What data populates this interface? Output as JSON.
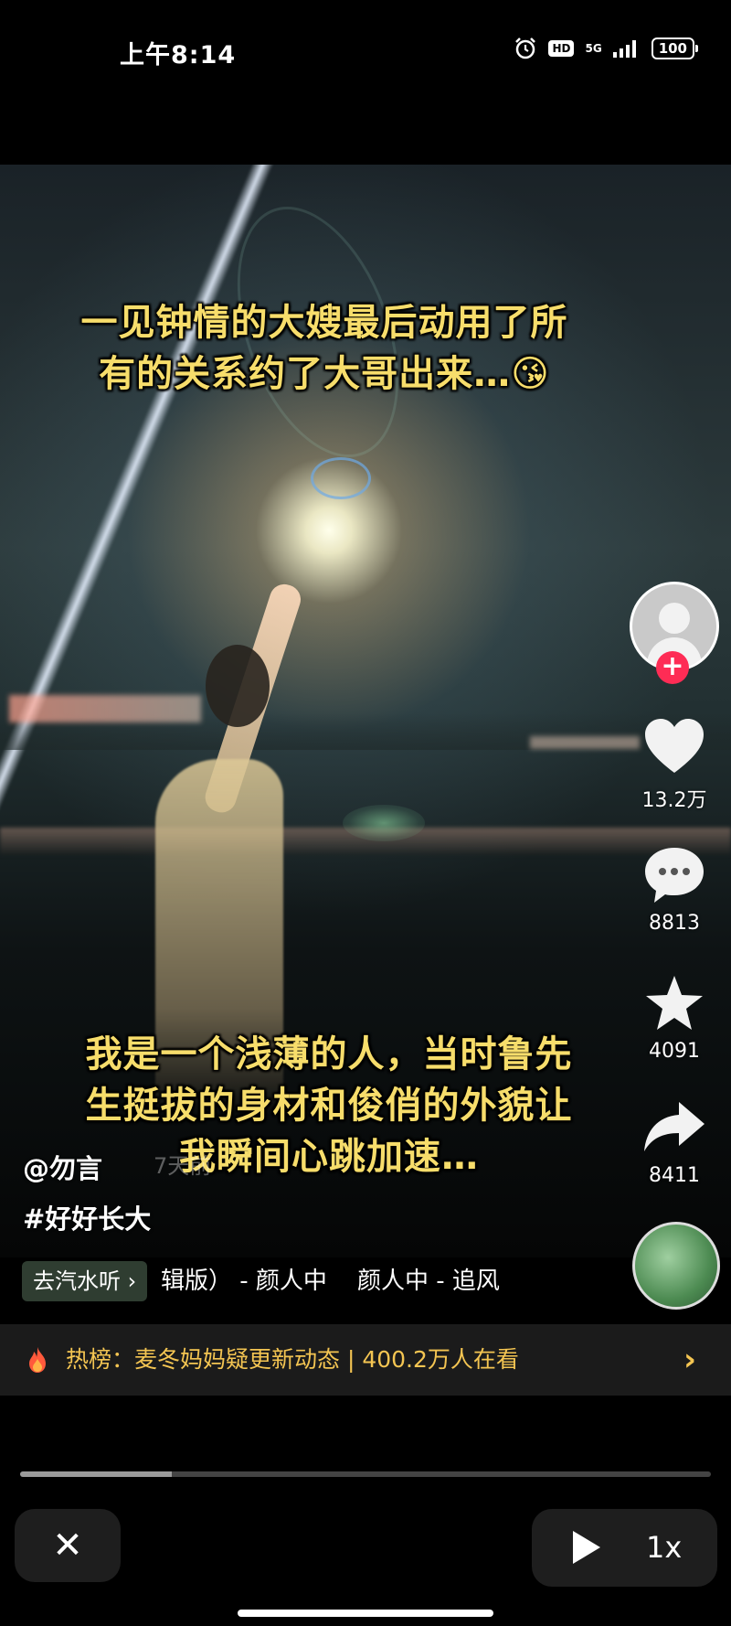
{
  "status_bar": {
    "time": "上午8:14",
    "hd": "HD",
    "network": "5G",
    "battery": "100"
  },
  "video": {
    "caption_top": [
      "一见钟情的大嫂最后动用了所",
      "有的关系约了大哥出来…😘"
    ],
    "caption_bottom": [
      "我是一个浅薄的人，当时鲁先",
      "生挺拔的身材和俊俏的外貌让",
      "我瞬间心跳加速…"
    ],
    "author": "@勿言",
    "author_time": "7天前",
    "hashtag": "#好好长大"
  },
  "rail": {
    "follow_symbol": "+",
    "likes": "13.2万",
    "comments": "8813",
    "favorites": "4091",
    "shares": "8411"
  },
  "music": {
    "listen_label": "去汽水听 ›",
    "track_text": "辑版） - 颜人中    颜人中 - 追风"
  },
  "hot": {
    "text": "热榜：麦冬妈妈疑更新动态 | 400.2万人在看",
    "chevron": "›"
  },
  "playback": {
    "progress_percent": 22,
    "close_symbol": "✕",
    "speed": "1x"
  },
  "colors": {
    "caption": "#f7dd6b",
    "hot_text": "#f4c552",
    "follow": "#fe2c55"
  }
}
